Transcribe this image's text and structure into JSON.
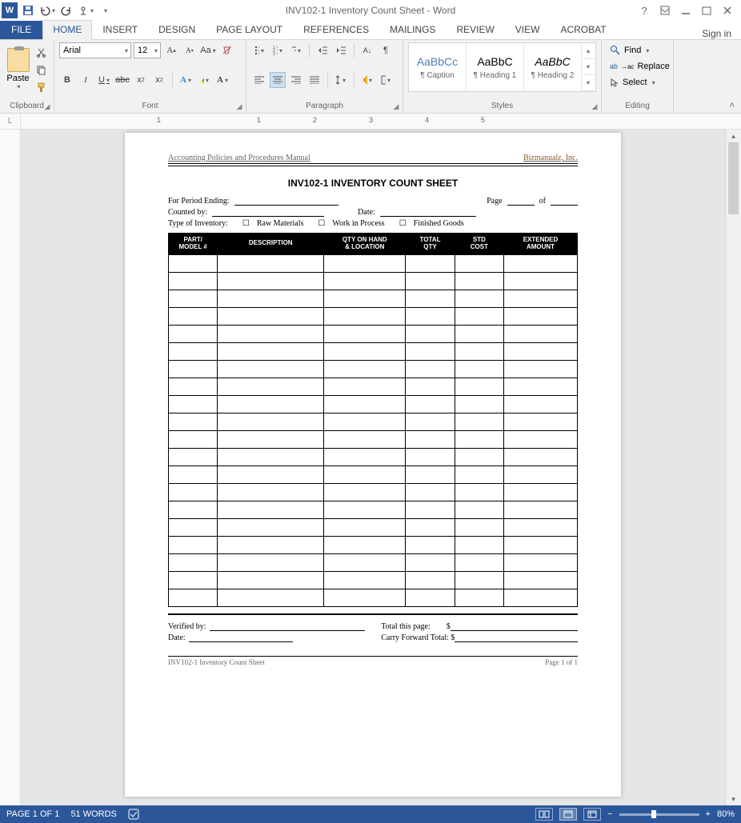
{
  "titlebar": {
    "title": "INV102-1 Inventory Count Sheet - Word",
    "help": "?"
  },
  "tabs": {
    "file": "FILE",
    "home": "HOME",
    "insert": "INSERT",
    "design": "DESIGN",
    "pagelayout": "PAGE LAYOUT",
    "references": "REFERENCES",
    "mailings": "MAILINGS",
    "review": "REVIEW",
    "view": "VIEW",
    "acrobat": "ACROBAT",
    "signin": "Sign in"
  },
  "ribbon": {
    "clipboard": {
      "label": "Clipboard",
      "paste": "Paste"
    },
    "font": {
      "label": "Font",
      "family": "Arial",
      "size": "12",
      "bold": "B",
      "italic": "I",
      "underline": "U"
    },
    "paragraph": {
      "label": "Paragraph"
    },
    "styles": {
      "label": "Styles",
      "preview": "AaBbCc",
      "items": [
        {
          "preview": "AaBbCc",
          "name": "¶ Caption"
        },
        {
          "preview": "AaBbC",
          "name": "¶ Heading 1"
        },
        {
          "preview": "AaBbC",
          "name": "¶ Heading 2",
          "italic": true
        }
      ]
    },
    "editing": {
      "label": "Editing",
      "find": "Find",
      "replace": "Replace",
      "select": "Select"
    }
  },
  "ruler": {
    "marks": [
      "1",
      "1",
      "2",
      "3",
      "4",
      "5"
    ]
  },
  "document": {
    "header_left": "Accounting Policies and Procedures Manual",
    "header_right": "Bizmanualz, Inc.",
    "title": "INV102-1 INVENTORY COUNT SHEET",
    "period_label": "For Period Ending:",
    "page_label": "Page",
    "page_of": "of",
    "counted_label": "Counted by:",
    "date_label": "Date:",
    "type_label": "Type of Inventory:",
    "type_opts": [
      "Raw Materials",
      "Work in Process",
      "Finished Goods"
    ],
    "columns": [
      "PART/\nMODEL #",
      "DESCRIPTION",
      "QTY ON HAND\n& LOCATION",
      "TOTAL\nQTY",
      "STD\nCOST",
      "EXTENDED\nAMOUNT"
    ],
    "blank_rows": 20,
    "verified_label": "Verified by:",
    "date2_label": "Date:",
    "total_page_label": "Total this page:",
    "carry_label": "Carry Forward Total: $",
    "dollar": "$",
    "footer_left": "INV102-1 Inventory Count Sheet",
    "footer_right": "Page 1 of 1"
  },
  "statusbar": {
    "page": "PAGE 1 OF 1",
    "words": "51 WORDS",
    "zoom": "80%",
    "plus": "+",
    "minus": "−"
  }
}
